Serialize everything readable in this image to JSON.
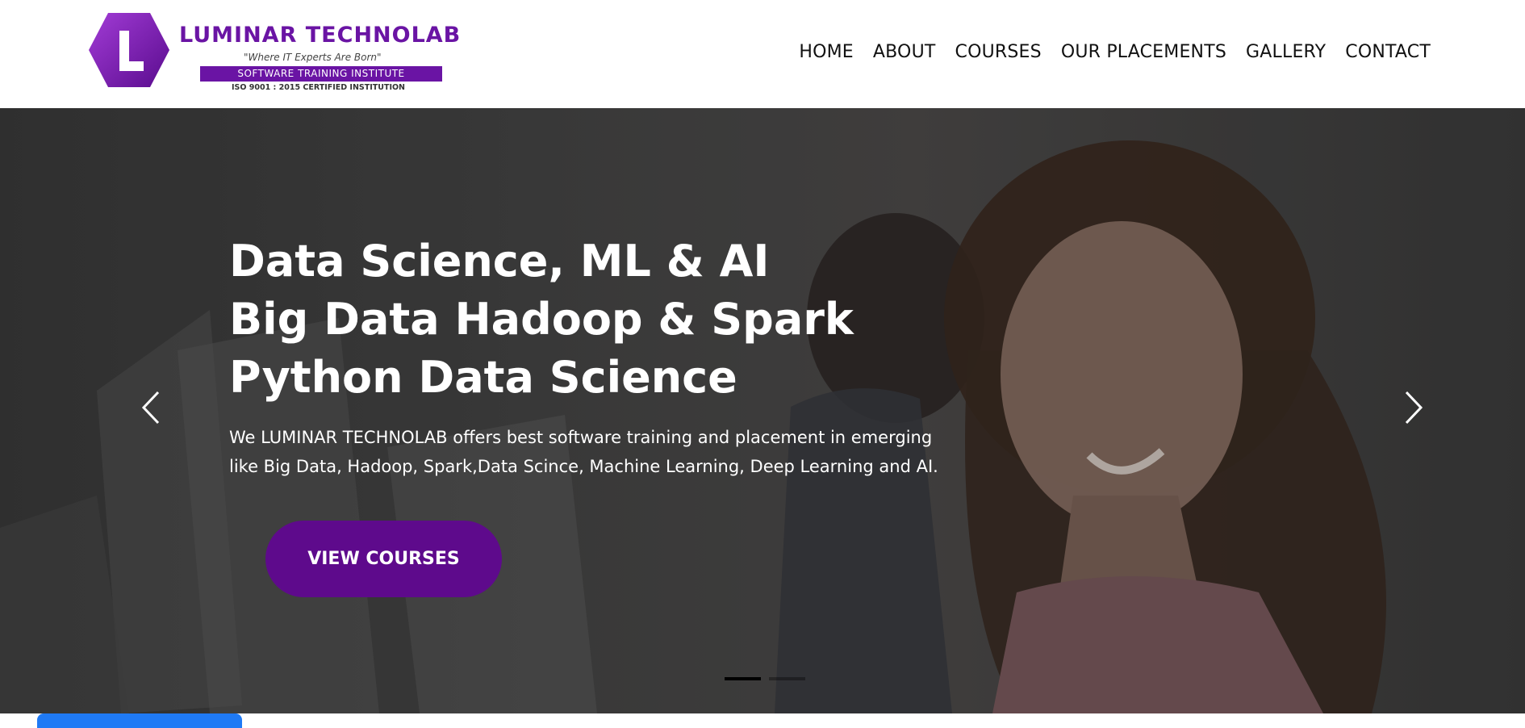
{
  "brand": {
    "name": "LUMINAR TECHNOLAB",
    "tagline": "\"Where IT Experts Are Born\"",
    "subtitle": "SOFTWARE TRAINING INSTITUTE",
    "certification": "ISO 9001 : 2015 CERTIFIED INSTITUTION",
    "logo_letter": "L",
    "accent_color": "#6a14a4"
  },
  "nav": {
    "items": [
      {
        "label": "HOME"
      },
      {
        "label": "ABOUT"
      },
      {
        "label": "COURSES"
      },
      {
        "label": "OUR PLACEMENTS"
      },
      {
        "label": "GALLERY"
      },
      {
        "label": "CONTACT"
      }
    ]
  },
  "hero": {
    "heading_lines": [
      "Data Science, ML & AI",
      "Big Data Hadoop & Spark",
      "Python Data Science"
    ],
    "description": "We LUMINAR TECHNOLAB offers best software training and placement in emerging like Big Data, Hadoop, Spark,Data Scince, Machine Learning, Deep Learning and AI.",
    "cta_label": "VIEW COURSES",
    "cta_color": "#5e0a8c",
    "prev_icon": "chevron-left-icon",
    "next_icon": "chevron-right-icon",
    "slides": {
      "total": 2,
      "active": 1
    }
  },
  "chat_widget": {
    "color": "#1f7af5"
  }
}
